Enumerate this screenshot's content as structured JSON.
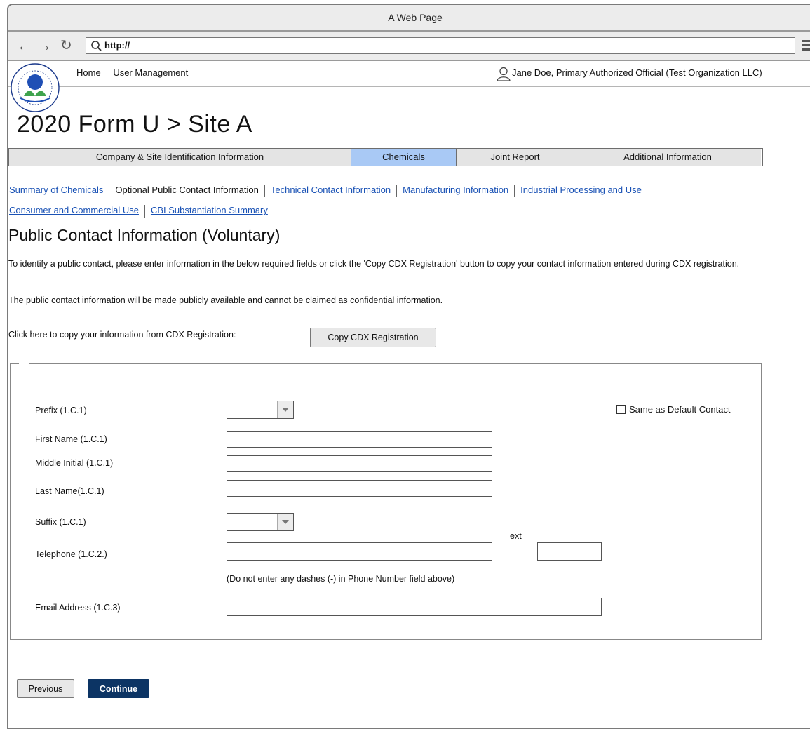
{
  "browser": {
    "title": "A Web Page",
    "url": "http://"
  },
  "header": {
    "nav": [
      "Home",
      "User Management"
    ],
    "user": "Jane Doe, Primary Authorized Official (Test Organization LLC)"
  },
  "page_title": "2020 Form U > Site A",
  "tabs": [
    {
      "label": "Company & Site Identification Information",
      "active": false
    },
    {
      "label": "Chemicals",
      "active": true
    },
    {
      "label": "Joint Report",
      "active": false
    },
    {
      "label": "Additional Information",
      "active": false
    }
  ],
  "subnav": [
    {
      "label": "Summary of Chemicals",
      "current": false
    },
    {
      "label": "Optional Public Contact Information",
      "current": true
    },
    {
      "label": "Technical Contact Information",
      "current": false
    },
    {
      "label": "Manufacturing Information",
      "current": false
    },
    {
      "label": "Industrial Processing and Use",
      "current": false
    },
    {
      "label": "Consumer and Commercial Use",
      "current": false
    },
    {
      "label": "CBI Substantiation Summary",
      "current": false
    }
  ],
  "section_title": "Public Contact Information (Voluntary)",
  "intro": "To identify a public contact, please enter information in the below required fields or click the 'Copy CDX Registration' button to copy your contact information entered during CDX registration.",
  "notice": "The public contact information will be made publicly available and cannot be claimed as confidential information.",
  "copy_prompt": "Click here to copy your information from CDX Registration:",
  "copy_button": "Copy CDX Registration",
  "form": {
    "prefix_label": "Prefix (1.C.1)",
    "prefix_value": "",
    "same_as_default_label": "Same as Default Contact",
    "same_as_default_checked": false,
    "first_name_label": "First Name (1.C.1)",
    "first_name_value": "",
    "middle_initial_label": "Middle Initial (1.C.1)",
    "middle_initial_value": "",
    "last_name_label": "Last Name(1.C.1)",
    "last_name_value": "",
    "suffix_label": "Suffix (1.C.1)",
    "suffix_value": "",
    "telephone_label": "Telephone (1.C.2.)",
    "telephone_value": "",
    "ext_label": "ext",
    "ext_value": "",
    "phone_hint": "(Do not enter any dashes (-) in Phone Number field above)",
    "email_label": "Email Address (1.C.3)",
    "email_value": ""
  },
  "buttons": {
    "previous": "Previous",
    "continue": "Continue"
  },
  "colors": {
    "active_tab": "#a9c9f5",
    "link": "#1a52b5",
    "primary_button": "#0c3464"
  }
}
